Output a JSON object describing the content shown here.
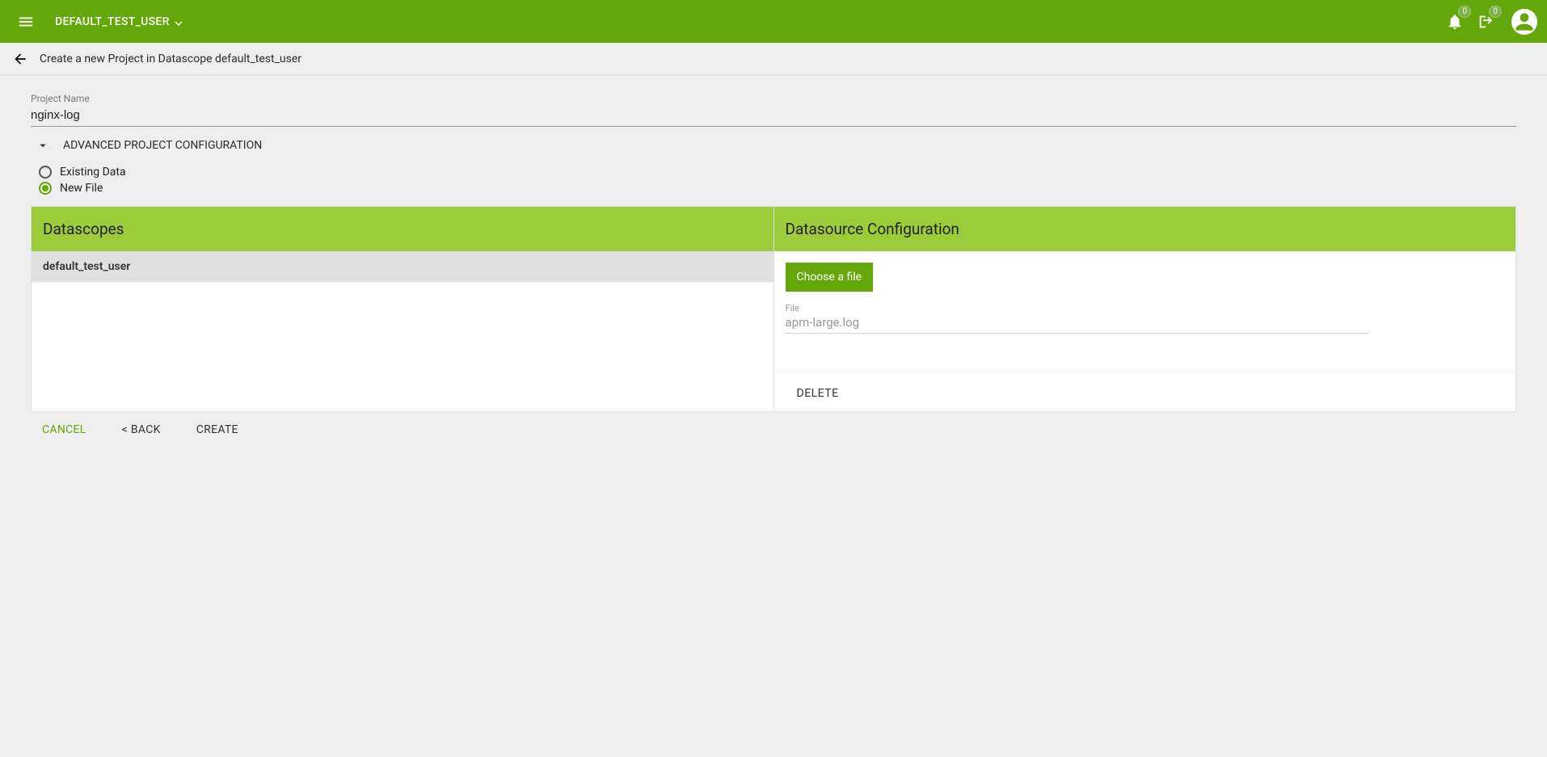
{
  "header": {
    "user_label": "DEFAULT_TEST_USER",
    "notification_badge": "0",
    "share_badge": "0"
  },
  "subheader": {
    "title": "Create a new Project in Datascope default_test_user"
  },
  "project": {
    "name_label": "Project Name",
    "name_value": "nginx-log",
    "advanced_label": "ADVANCED PROJECT CONFIGURATION"
  },
  "data_source_mode": {
    "existing_label": "Existing Data",
    "new_label": "New File",
    "selected": "new"
  },
  "panels": {
    "left_title": "Datascopes",
    "left_items": [
      "default_test_user"
    ],
    "right_title": "Datasource Configuration",
    "choose_file_label": "Choose a file",
    "file_label": "File",
    "file_value": "apm-large.log",
    "delete_label": "DELETE"
  },
  "footer": {
    "cancel": "CANCEL",
    "back": "< BACK",
    "create": "CREATE"
  }
}
